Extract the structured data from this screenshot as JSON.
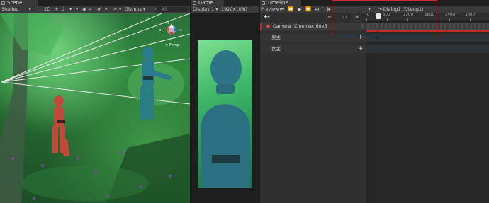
{
  "scene": {
    "tab_label": "Scene",
    "shading": "Shaded",
    "toggle_2d": "2D",
    "gizmos": "Gizmos",
    "search_placeholder": "All",
    "persp_label": "< Persp"
  },
  "game": {
    "tab_label": "Game",
    "display": "Display 1",
    "resolution": "1920x1080"
  },
  "timeline": {
    "tab_label": "Timeline",
    "preview_label": "Preview",
    "current_frame": "385",
    "asset_label": "Dialog1 (Dialog1)",
    "ruler_ticks": [
      "0",
      "600",
      "1200",
      "1800",
      "2400",
      "3000"
    ],
    "tracks": [
      {
        "label": "Camera (CinemachineB"
      },
      {
        "label": "男主"
      },
      {
        "label": "女主"
      }
    ]
  },
  "colors": {
    "highlight_box": "#d62c2c",
    "player_red": "#c14a3a",
    "player_teal": "#2b7c8a"
  }
}
